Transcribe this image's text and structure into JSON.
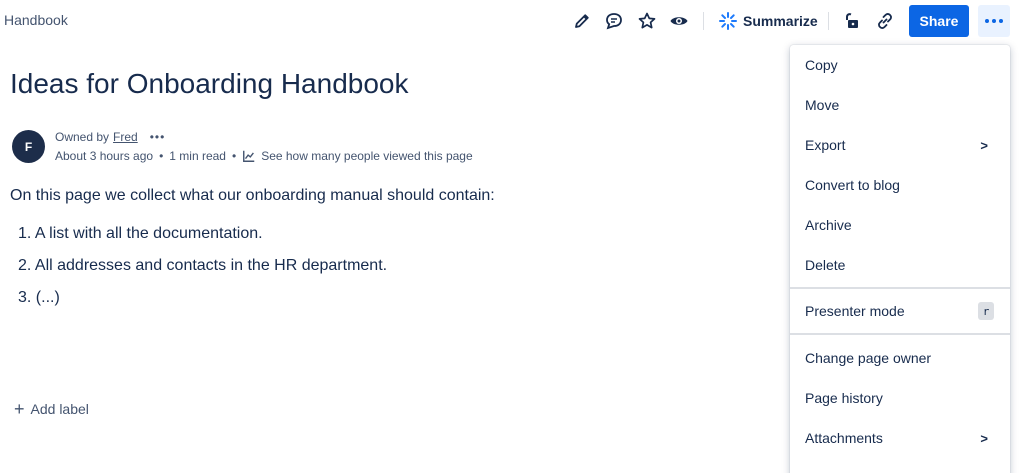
{
  "header": {
    "breadcrumb": "Handbook",
    "summarize_label": "Summarize",
    "share_label": "Share",
    "icons": [
      "edit-icon",
      "comment-icon",
      "star-icon",
      "watch-icon",
      "restrictions-icon",
      "link-icon"
    ],
    "accent_color": "#0c66e4"
  },
  "page": {
    "title": "Ideas for Onboarding Handbook",
    "avatar_initial": "F",
    "owned_by_label": "Owned by",
    "owner_name": "Fred",
    "updated": "About 3 hours ago",
    "read_time": "1 min read",
    "views_link": "See how many people viewed this page",
    "intro": "On this page we collect what our onboarding manual should contain:",
    "list_items": [
      "1. A list with all the documentation.",
      "2. All addresses and contacts in the HR department.",
      "3. (...)"
    ],
    "add_label": "Add label"
  },
  "menu": {
    "copy": "Copy",
    "move": "Move",
    "export": "Export",
    "convert_to_blog": "Convert to blog",
    "archive": "Archive",
    "delete": "Delete",
    "presenter_mode": "Presenter mode",
    "presenter_shortcut": "r",
    "change_page_owner": "Change page owner",
    "page_history": "Page history",
    "attachments": "Attachments"
  }
}
